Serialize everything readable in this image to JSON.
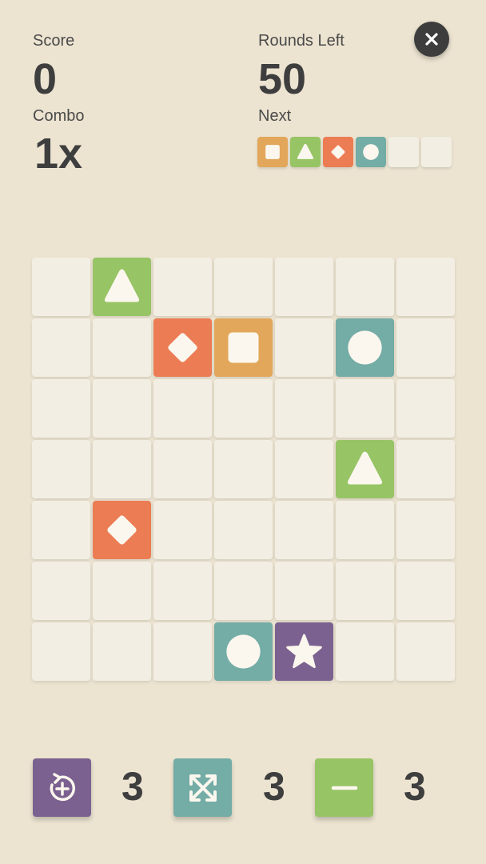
{
  "colors": {
    "background": "#ece4d1",
    "empty_cell": "#f3eee3",
    "square": "#e2a75a",
    "triangle": "#97c465",
    "diamond": "#ec7c54",
    "circle": "#74aca6",
    "star": "#7b6190",
    "text": "#3e3e3e"
  },
  "hud": {
    "score_label": "Score",
    "score_value": "0",
    "rounds_label": "Rounds Left",
    "rounds_value": "50",
    "combo_label": "Combo",
    "combo_value": "1x",
    "next_label": "Next"
  },
  "close_icon": "close-icon",
  "next_queue": [
    "square",
    "triangle",
    "diamond",
    "circle",
    "empty",
    "empty"
  ],
  "board": [
    [
      "empty",
      "triangle",
      "empty",
      "empty",
      "empty",
      "empty",
      "empty"
    ],
    [
      "empty",
      "empty",
      "diamond",
      "square",
      "empty",
      "circle",
      "empty"
    ],
    [
      "empty",
      "empty",
      "empty",
      "empty",
      "empty",
      "empty",
      "empty"
    ],
    [
      "empty",
      "empty",
      "empty",
      "empty",
      "empty",
      "triangle",
      "empty"
    ],
    [
      "empty",
      "diamond",
      "empty",
      "empty",
      "empty",
      "empty",
      "empty"
    ],
    [
      "empty",
      "empty",
      "empty",
      "empty",
      "empty",
      "empty",
      "empty"
    ],
    [
      "empty",
      "empty",
      "empty",
      "circle",
      "star",
      "empty",
      "empty"
    ]
  ],
  "powerups": [
    {
      "name": "shuffle",
      "icon": "rotate-plus-icon",
      "count": "3",
      "color": "#7b6190"
    },
    {
      "name": "expand",
      "icon": "expand-arrows-icon",
      "count": "3",
      "color": "#74aca6"
    },
    {
      "name": "minus",
      "icon": "minus-icon",
      "count": "3",
      "color": "#97c465"
    }
  ]
}
